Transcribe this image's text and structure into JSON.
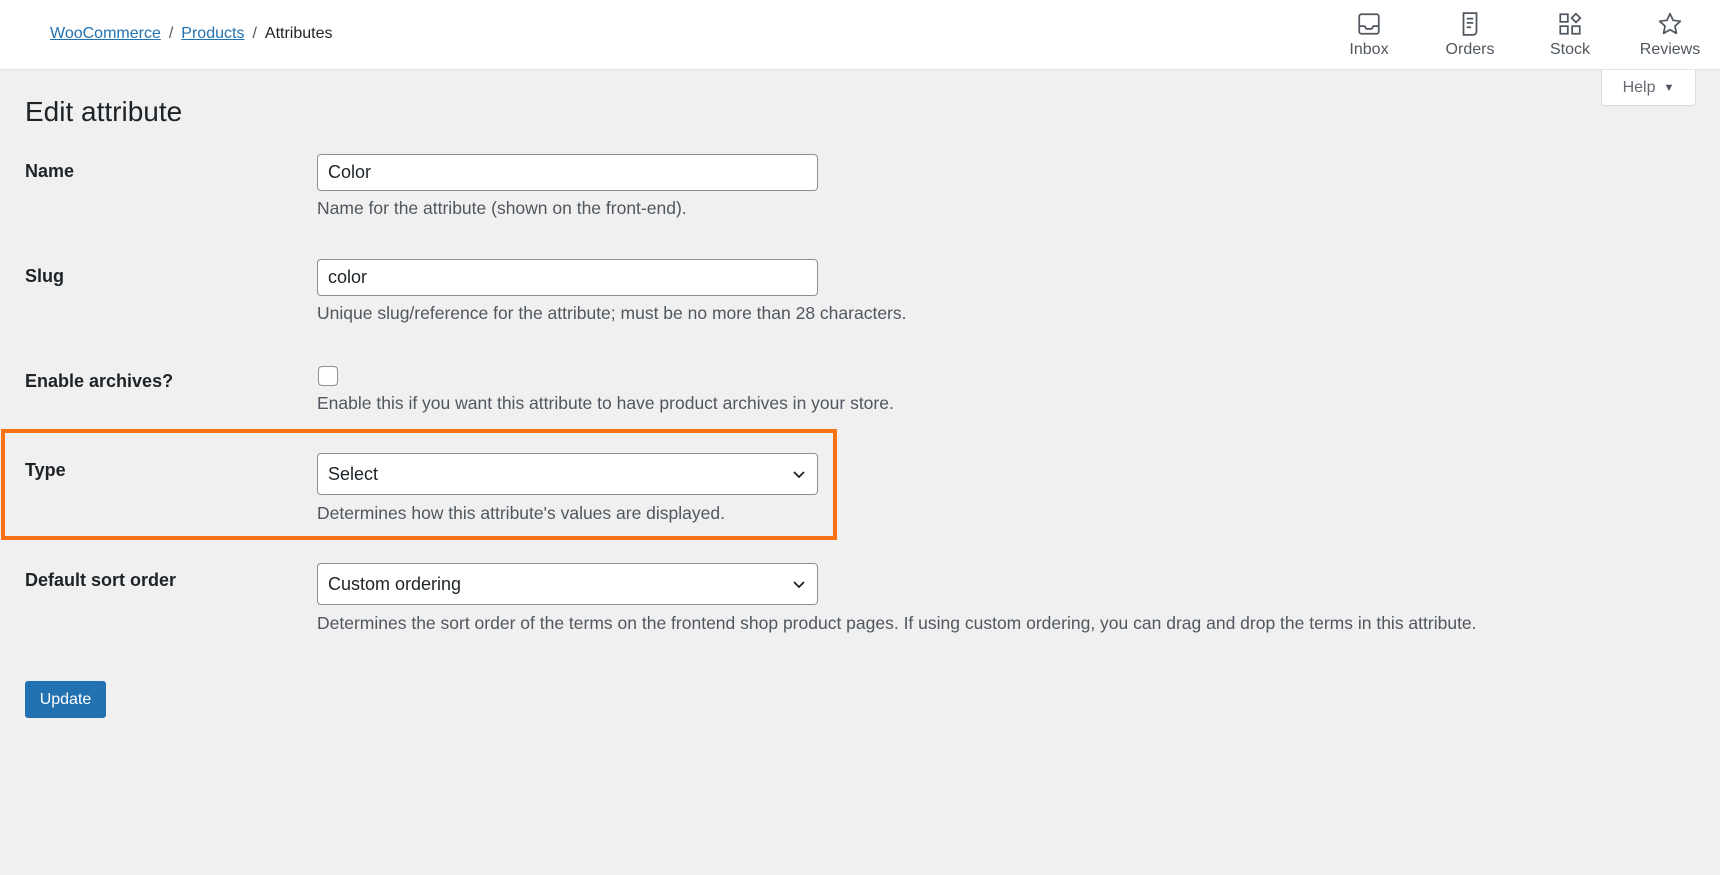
{
  "breadcrumb": {
    "items": [
      {
        "label": "WooCommerce"
      },
      {
        "label": "Products"
      }
    ],
    "separator": "/",
    "current": "Attributes"
  },
  "activity_bar": {
    "inbox": {
      "label": "Inbox",
      "icon": "inbox-icon"
    },
    "orders": {
      "label": "Orders",
      "icon": "orders-icon"
    },
    "stock": {
      "label": "Stock",
      "icon": "stock-icon"
    },
    "reviews": {
      "label": "Reviews",
      "icon": "star-icon"
    }
  },
  "help": {
    "label": "Help",
    "caret": "▼"
  },
  "page_title": "Edit attribute",
  "form": {
    "name": {
      "label": "Name",
      "value": "Color",
      "description": "Name for the attribute (shown on the front-end)."
    },
    "slug": {
      "label": "Slug",
      "value": "color",
      "description": "Unique slug/reference for the attribute; must be no more than 28 characters."
    },
    "archives": {
      "label": "Enable archives?",
      "checked": false,
      "description": "Enable this if you want this attribute to have product archives in your store."
    },
    "type": {
      "label": "Type",
      "selected": "Select",
      "description": "Determines how this attribute's values are displayed."
    },
    "sort_order": {
      "label": "Default sort order",
      "selected": "Custom ordering",
      "description": "Determines the sort order of the terms on the frontend shop product pages. If using custom ordering, you can drag and drop the terms in this attribute."
    }
  },
  "update_button": "Update",
  "colors": {
    "accent": "#2271b1",
    "highlight": "#f97316",
    "background": "#f0f0f1"
  }
}
